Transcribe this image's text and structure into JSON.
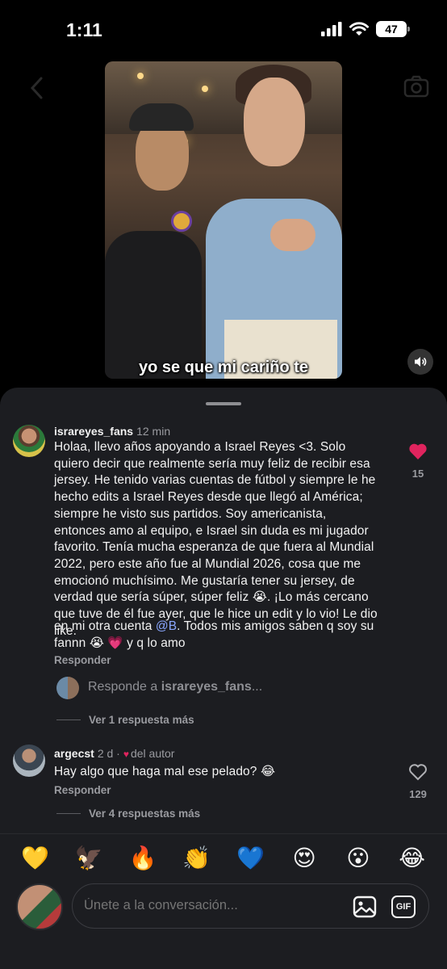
{
  "status_bar": {
    "time": "1:11",
    "battery": "47"
  },
  "video": {
    "caption": "yo se que mi cariño te"
  },
  "comments": [
    {
      "username": "israreyes_fans",
      "time": "12 min",
      "text_main": "Holaa, llevo años apoyando a Israel Reyes <3. Solo quiero decir que realmente sería muy feliz de recibir esa jersey. He tenido varias cuentas de fútbol y siempre le he hecho edits a Israel Reyes desde que llegó al América; siempre he visto sus partidos. Soy americanista, entonces amo al equipo, e Israel sin duda es mi jugador favorito. Tenía mucha esperanza de que fuera al Mundial 2022, pero este año fue al Mundial 2026, cosa que me emocionó muchísimo. Me gustaría tener su jersey, de verdad que sería súper, súper feliz",
      "text_main_emoji": "😭",
      "text_main_tail": ". ¡Lo más cercano que tuve de él fue ayer, que le hice un edit y lo vio! Le dio like.",
      "text_second_pre": "en mi otra cuenta ",
      "mention": "@B",
      "text_second_post": ". Todos mis amigos saben q soy su fannn ",
      "text_second_emojis": "😭 💗",
      "text_second_tail": " y q lo amo",
      "reply_label": "Responder",
      "likes": "15",
      "liked": true,
      "reply_prompt_prefix": "Responde a ",
      "reply_prompt_user": "israreyes_fans",
      "reply_prompt_suffix": "...",
      "view_more": "Ver 1 respuesta más"
    },
    {
      "username": "argecst",
      "time": "2 d",
      "author_badge": "del autor",
      "text": "Hay algo que haga mal ese pelado? 😂",
      "reply_label": "Responder",
      "likes": "129",
      "liked": false,
      "view_more": "Ver 4 respuestas más"
    }
  ],
  "emoji_bar": [
    "💛",
    "🦅",
    "🔥",
    "👏",
    "💙",
    "😍",
    "😮",
    "😂"
  ],
  "composer": {
    "placeholder": "Únete a la conversación...",
    "gif_label": "GIF"
  },
  "colors": {
    "sheet_bg": "#1c1d21",
    "like_red": "#e0245e",
    "mention_blue": "#8aa7ff"
  }
}
